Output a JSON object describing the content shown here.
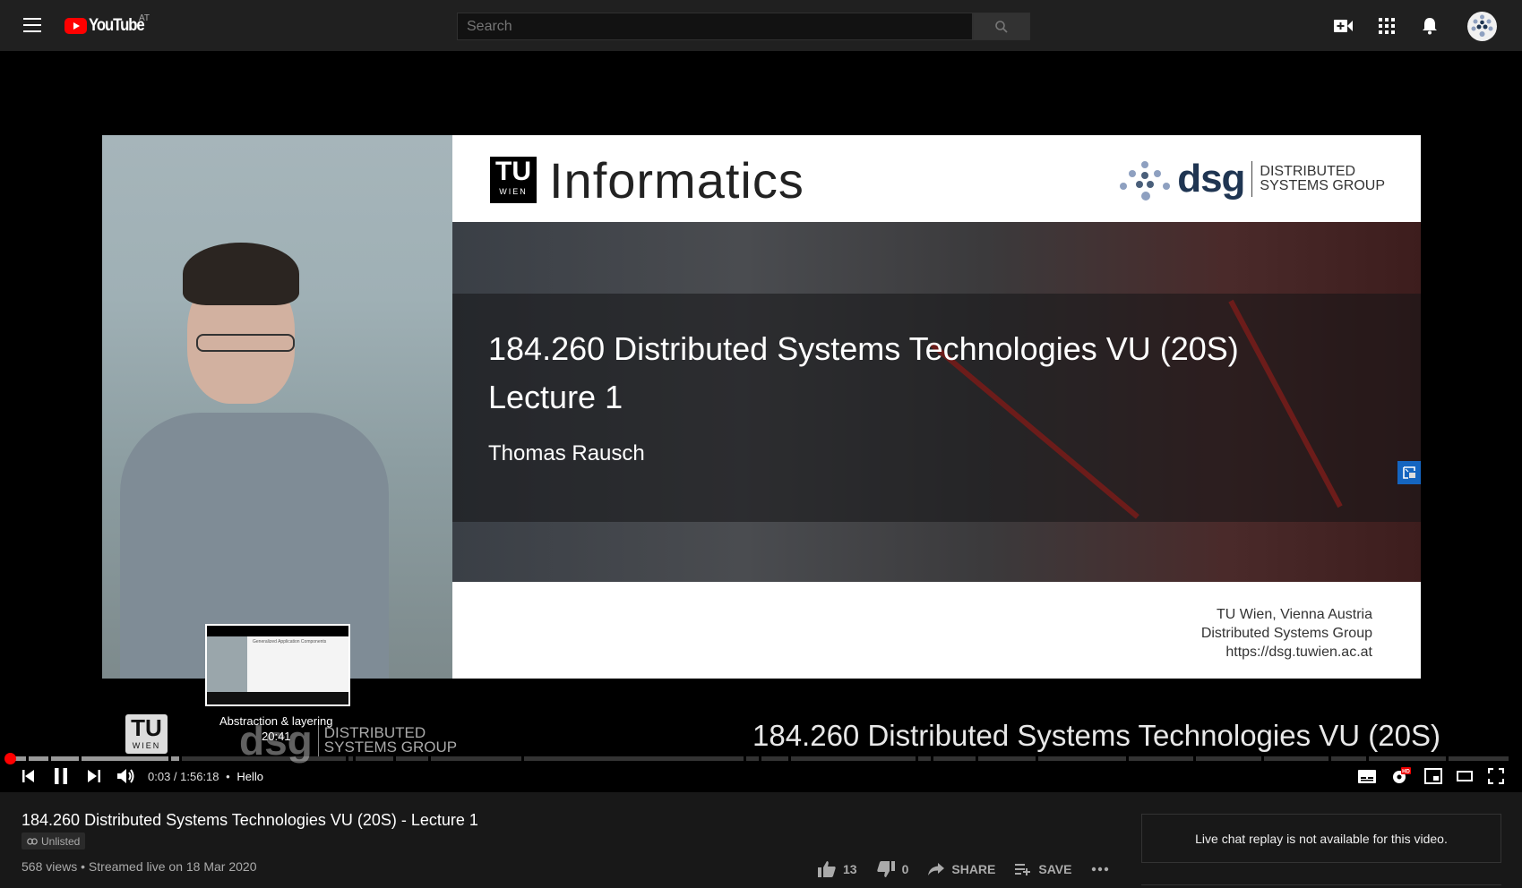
{
  "header": {
    "logo_text": "YouTube",
    "country_code": "AT",
    "search_placeholder": "Search",
    "icons": [
      "menu-icon",
      "create-video-icon",
      "apps-icon",
      "notifications-icon",
      "avatar"
    ]
  },
  "player": {
    "slide": {
      "brand": "Informatics",
      "tu_logo_top": "TU",
      "tu_logo_bottom": "WIEN",
      "dsg_mark": "dsg",
      "dsg_full": "DISTRIBUTED SYSTEMS GROUP",
      "dsg_full_line1": "DISTRIBUTED",
      "dsg_full_line2": "SYSTEMS GROUP",
      "title": "184.260 Distributed Systems Technologies VU (20S)",
      "subtitle": "Lecture 1",
      "author": "Thomas Rausch",
      "footer_line1": "TU Wien, Vienna Austria",
      "footer_line2": "Distributed Systems Group",
      "footer_line3": "https://dsg.tuwien.ac.at"
    },
    "bottom_band": {
      "tu_top": "TU",
      "tu_bottom": "WIEN",
      "dsg_mark": "dsg",
      "dsg_line1": "DISTRIBUTED",
      "dsg_line2": "SYSTEMS GROUP",
      "title": "184.260 Distributed Systems Technologies VU (20S)"
    },
    "preview": {
      "chapter_title": "Abstraction & layering",
      "chapter_time": "20:41",
      "thumb_slide_title": "Generalized Application Components"
    },
    "progress": {
      "played_fraction": 0.0004,
      "hover_fraction": 0.178,
      "chapter_boundaries_fraction": [
        0,
        0.012,
        0.027,
        0.047,
        0.107,
        0.114,
        0.225,
        0.23,
        0.257,
        0.28,
        0.342,
        0.49,
        0.5,
        0.52,
        0.605,
        0.615,
        0.645,
        0.685,
        0.745,
        0.79,
        0.835,
        0.88,
        0.905,
        0.958,
        1.0
      ]
    },
    "controls": {
      "current_time": "0:03",
      "duration": "1:56:18",
      "chapter": "Hello",
      "time_text": "0:03 / 1:56:18",
      "chapter_sep": "•",
      "quality_badge": "HD"
    }
  },
  "info": {
    "title": "184.260 Distributed Systems Technologies VU (20S) - Lecture 1",
    "privacy": "Unlisted",
    "views_line": "568 views • Streamed live on 18 Mar 2020",
    "likes": "13",
    "dislikes": "0",
    "share_label": "SHARE",
    "save_label": "SAVE"
  },
  "chat": {
    "message": "Live chat replay is not available for this video."
  },
  "colors": {
    "brand_red": "#ff0000",
    "background": "#181818",
    "header_bg": "#202020",
    "pip_blue": "#1565c0"
  }
}
